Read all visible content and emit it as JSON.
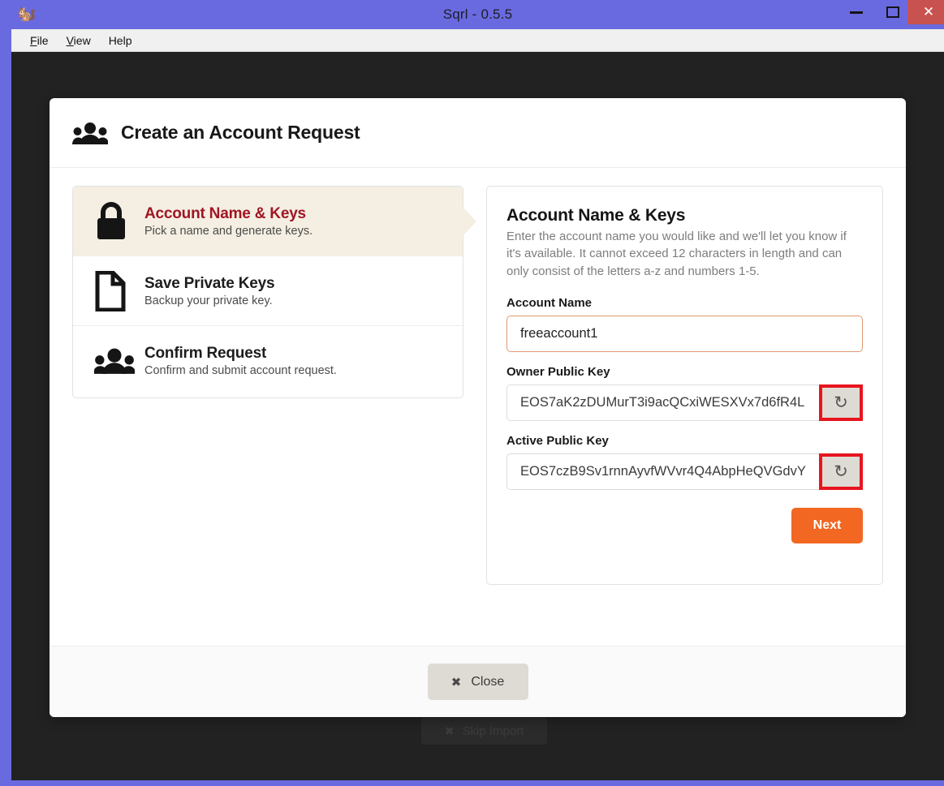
{
  "window": {
    "title": "Sqrl - 0.5.5",
    "app_icon": "squirrel-icon",
    "controls": {
      "minimize": "–",
      "maximize": "▢",
      "close": "✕"
    }
  },
  "menubar": {
    "items": [
      {
        "label": "File",
        "accel": "F"
      },
      {
        "label": "View",
        "accel": "V"
      },
      {
        "label": "Help",
        "accel": "H"
      }
    ]
  },
  "background": {
    "skip_import_label": "Skip Import",
    "skip_import_icon": "✖"
  },
  "dialog": {
    "header": {
      "title": "Create an Account Request",
      "icon": "users-group-icon"
    },
    "steps": [
      {
        "label": "Account Name & Keys",
        "desc": "Pick a name and generate keys.",
        "icon": "lock-icon",
        "active": true
      },
      {
        "label": "Save Private Keys",
        "desc": "Backup your private key.",
        "icon": "document-icon",
        "active": false
      },
      {
        "label": "Confirm Request",
        "desc": "Confirm and submit account request.",
        "icon": "users-group-icon",
        "active": false
      }
    ],
    "panel": {
      "title": "Account Name & Keys",
      "description": "Enter the account name you would like and we'll let you know if it's available. It cannot exceed 12 characters in length and can only consist of the letters a-z and numbers 1-5.",
      "fields": {
        "account_name": {
          "label": "Account Name",
          "value": "freeaccount1",
          "placeholder": "",
          "focused": true
        },
        "owner_public_key": {
          "label": "Owner Public Key",
          "value": "EOS7aK2zDUMurT3i9acQCxiWESXVx7d6fR4L",
          "refresh_icon": "↻",
          "highlighted": true
        },
        "active_public_key": {
          "label": "Active Public Key",
          "value": "EOS7czB9Sv1rnnAyvfWVvr4Q4AbpHeQVGdvY",
          "refresh_icon": "↻",
          "highlighted": true
        }
      },
      "next_label": "Next"
    },
    "footer": {
      "close_label": "Close",
      "close_icon": "✖"
    }
  },
  "colors": {
    "titlebar": "#6a6ae0",
    "close_button": "#c7524f",
    "app_background": "#222222",
    "active_step_bg": "#f4efe2",
    "active_step_text": "#a01525",
    "accent_orange": "#f26722",
    "highlight_red": "#e8141e",
    "input_focus_border": "#e09a72"
  }
}
